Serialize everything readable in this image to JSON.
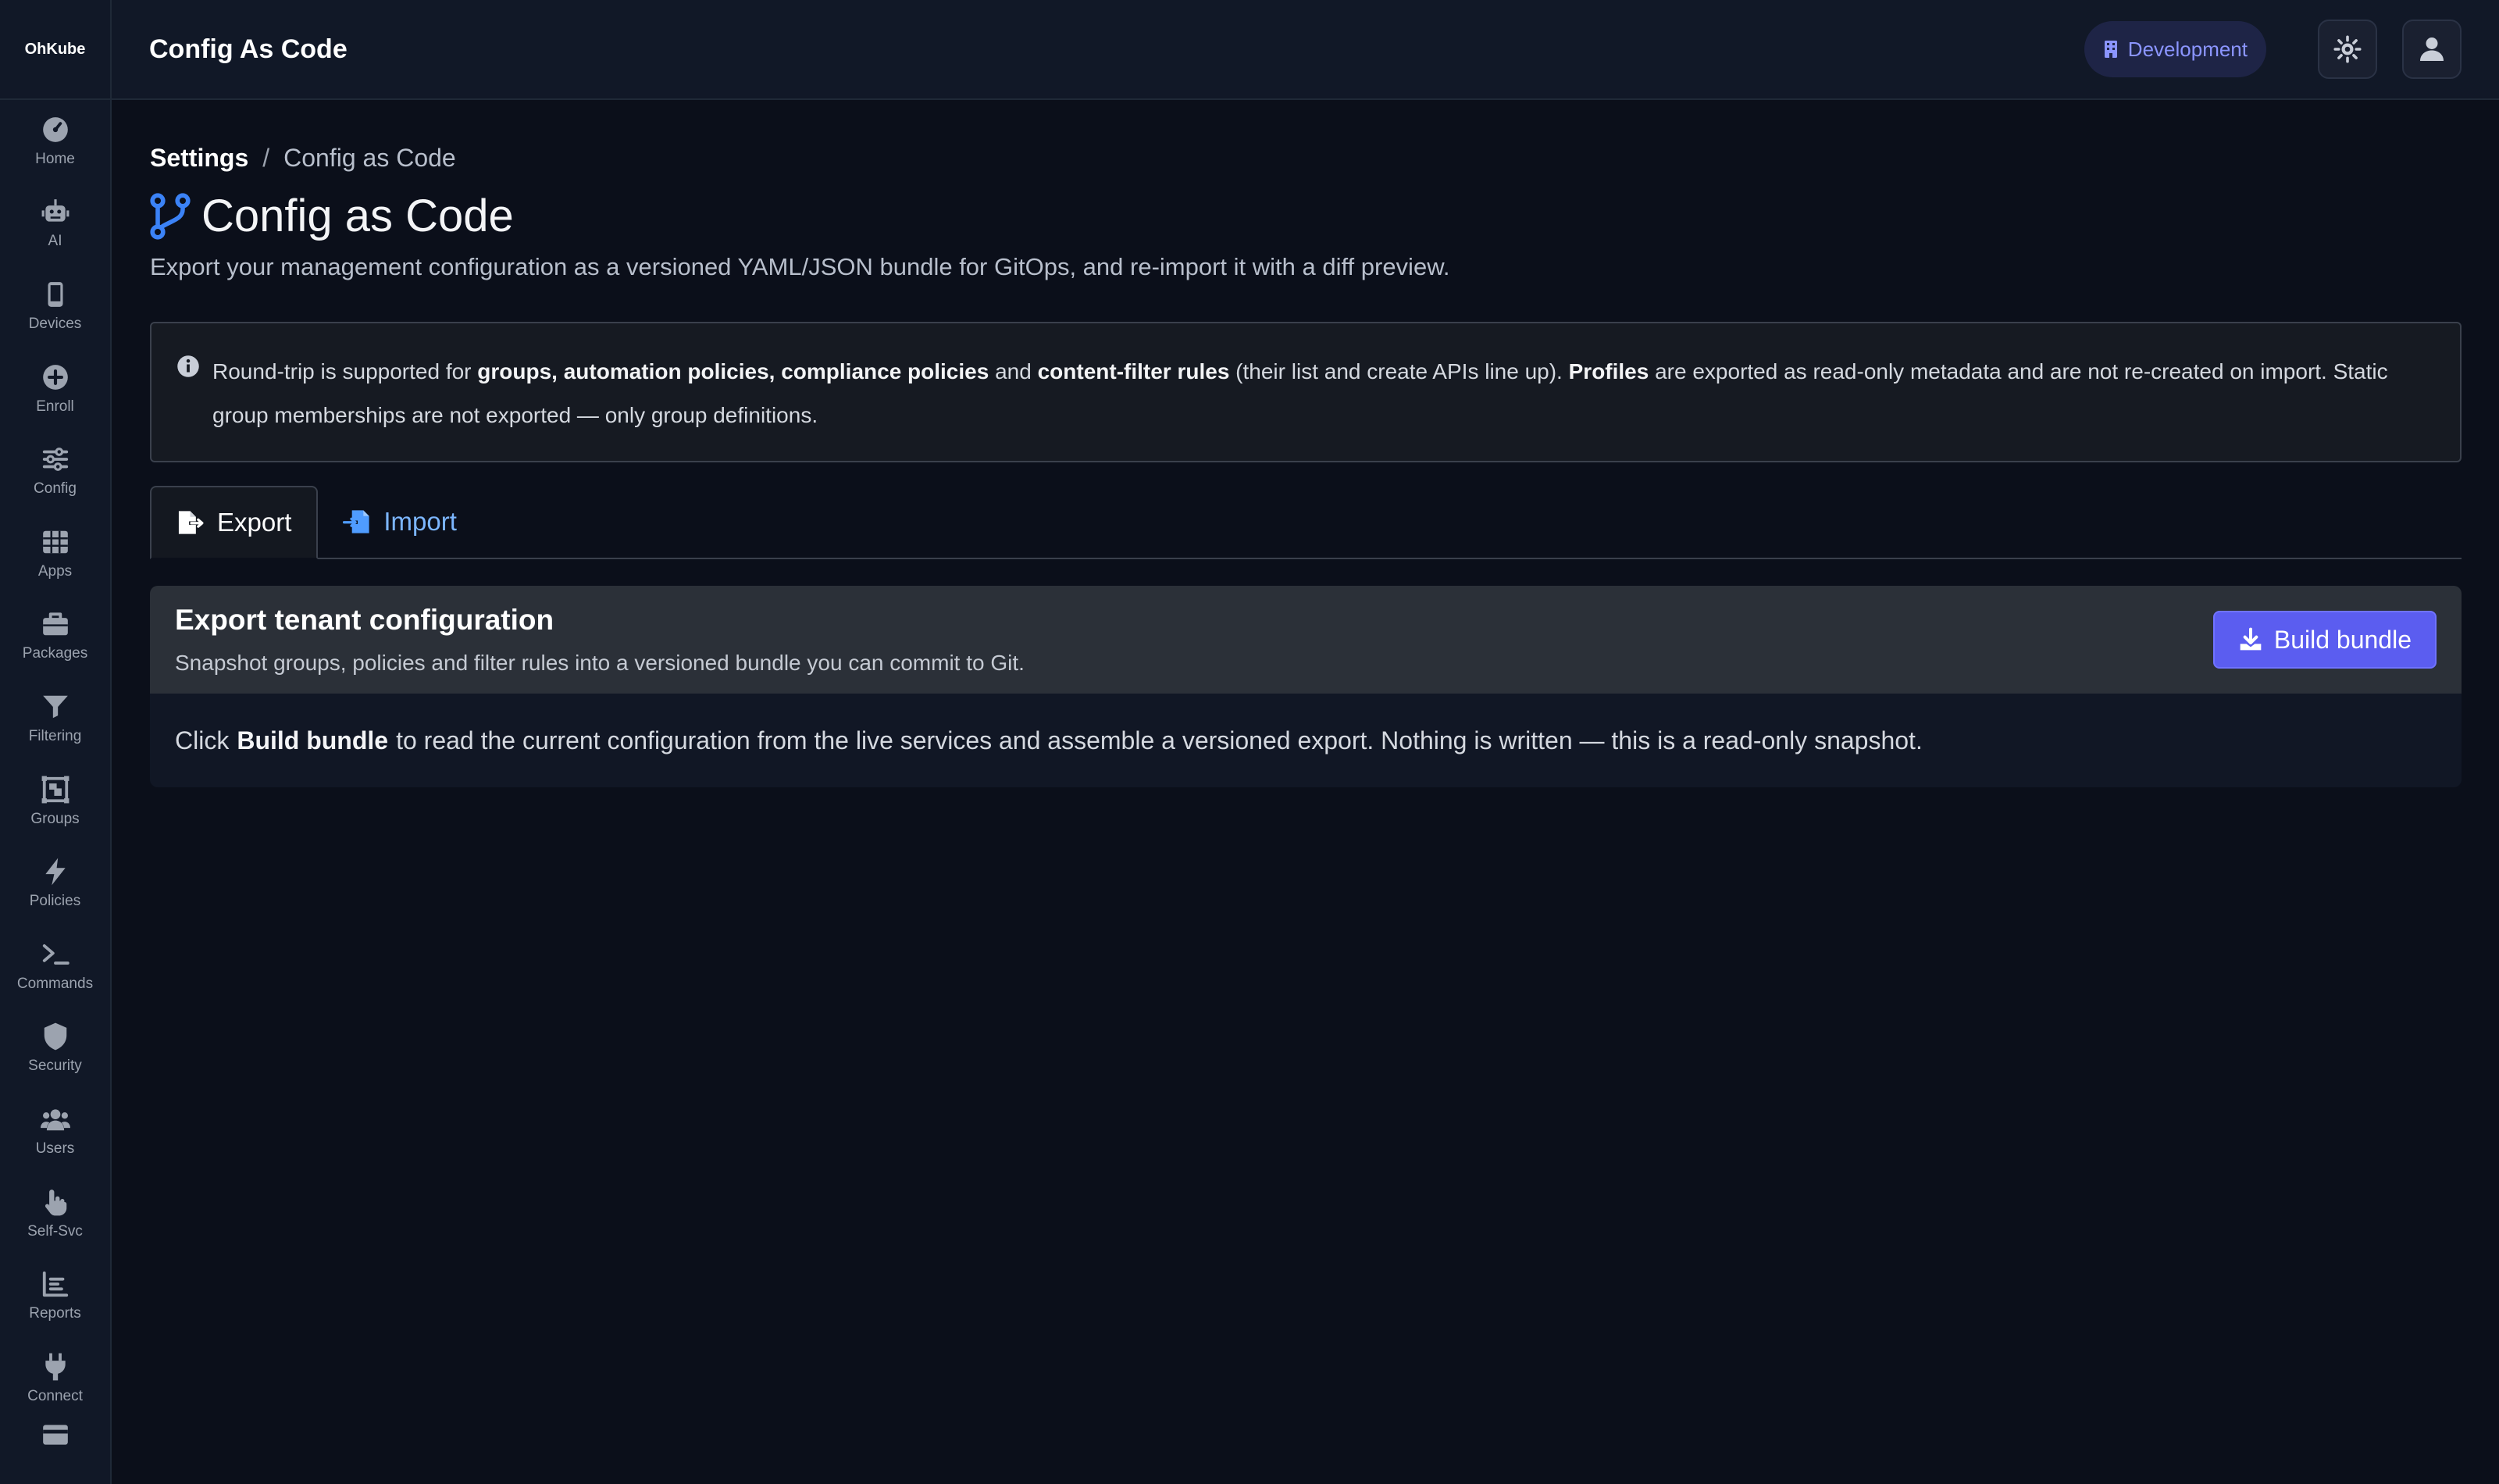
{
  "app": {
    "logo_text": "OhKube"
  },
  "sidebar": {
    "items": [
      {
        "label": "Home",
        "icon": "gauge-icon"
      },
      {
        "label": "AI",
        "icon": "robot-icon"
      },
      {
        "label": "Devices",
        "icon": "mobile-icon"
      },
      {
        "label": "Enroll",
        "icon": "plus-circle-icon"
      },
      {
        "label": "Config",
        "icon": "sliders-icon"
      },
      {
        "label": "Apps",
        "icon": "grid-icon"
      },
      {
        "label": "Packages",
        "icon": "briefcase-icon"
      },
      {
        "label": "Filtering",
        "icon": "filter-icon"
      },
      {
        "label": "Groups",
        "icon": "object-group-icon"
      },
      {
        "label": "Policies",
        "icon": "bolt-icon"
      },
      {
        "label": "Commands",
        "icon": "terminal-icon"
      },
      {
        "label": "Security",
        "icon": "shield-icon"
      },
      {
        "label": "Users",
        "icon": "users-icon"
      },
      {
        "label": "Self-Svc",
        "icon": "hand-pointer-icon"
      },
      {
        "label": "Reports",
        "icon": "chart-icon"
      },
      {
        "label": "Connect",
        "icon": "plug-icon"
      }
    ]
  },
  "header": {
    "title": "Config As Code",
    "environment": "Development"
  },
  "breadcrumb": {
    "parent": "Settings",
    "separator": "/",
    "current": "Config as Code"
  },
  "page": {
    "title": "Config as Code",
    "subtitle": "Export your management configuration as a versioned YAML/JSON bundle for GitOps, and re-import it with a diff preview."
  },
  "info": {
    "t1": "Round-trip is supported for ",
    "b1": "groups, automation policies, compliance policies",
    "t2": " and ",
    "b2": "content-filter rules",
    "t3": " (their list and create APIs line up). ",
    "b3": "Profiles",
    "t4": " are exported as read-only metadata and are not re-created on import. Static group memberships are not exported — only group definitions."
  },
  "tabs": {
    "export_label": "Export",
    "import_label": "Import"
  },
  "export_card": {
    "title": "Export tenant configuration",
    "description": "Snapshot groups, policies and filter rules into a versioned bundle you can commit to Git.",
    "button_label": "Build bundle",
    "body_prefix": "Click",
    "body_bold": "Build bundle",
    "body_suffix": "to read the current configuration from the live services and assemble a versioned export. Nothing is written — this is a read-only snapshot."
  },
  "colors": {
    "background": "#0b0f1a",
    "accent": "#5b5df0",
    "link": "#7cb6ff",
    "title_icon": "#3b82f6"
  }
}
